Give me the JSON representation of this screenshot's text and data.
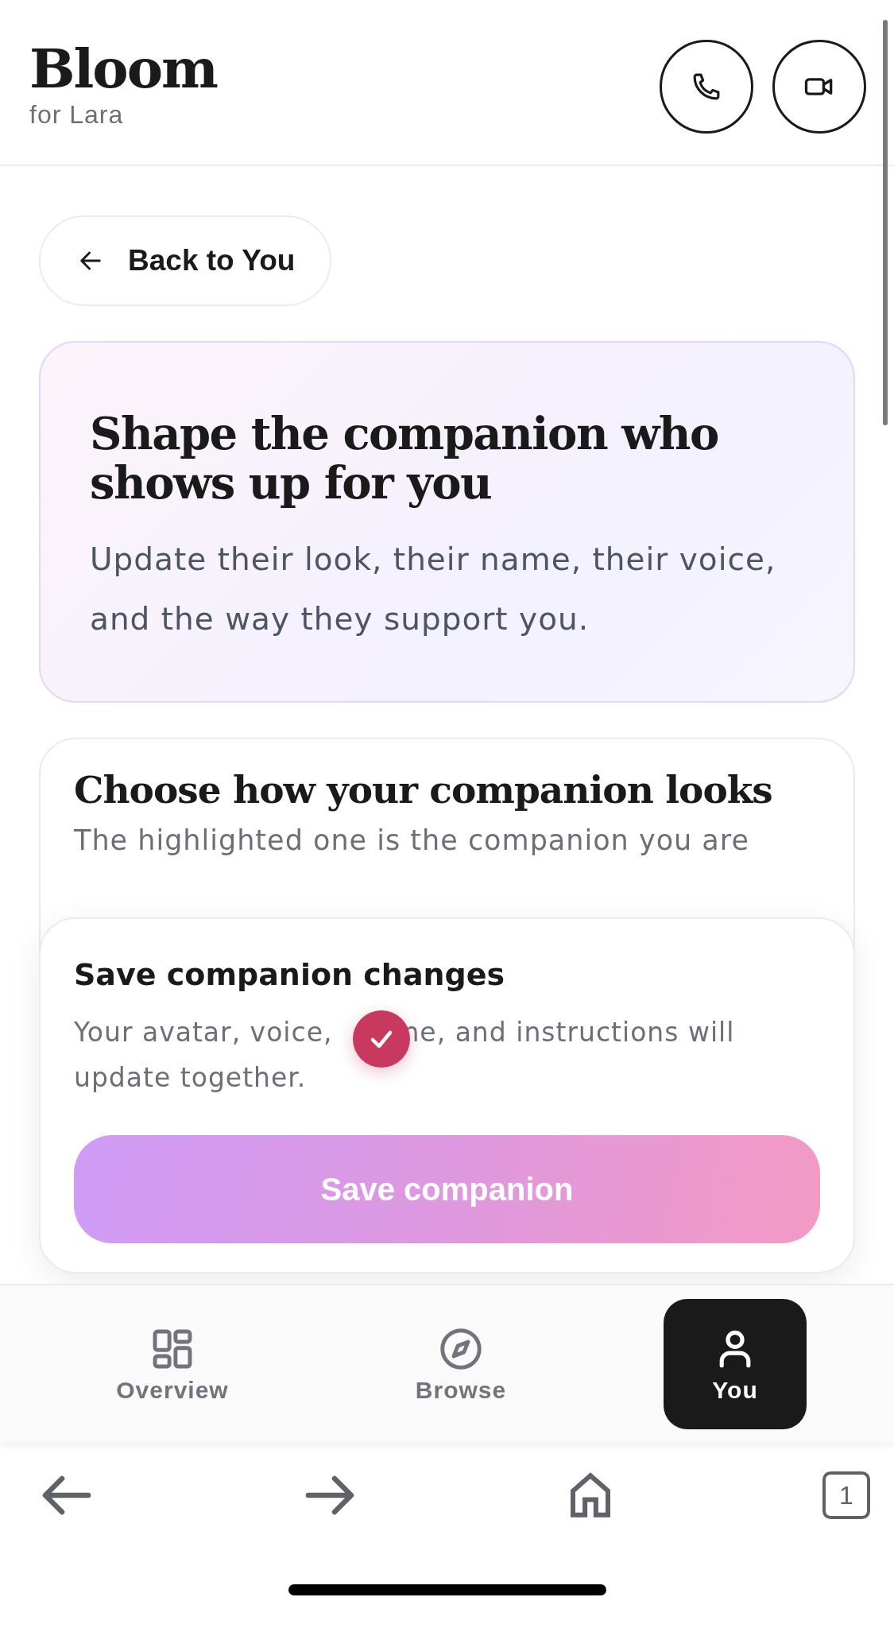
{
  "header": {
    "title": "Bloom",
    "subtitle": "for Lara"
  },
  "back_button": {
    "label": "Back to You"
  },
  "hero": {
    "title": "Shape the companion who shows up for you",
    "description": "Update their look, their name, their voice, and the way they support you."
  },
  "appearance_section": {
    "title": "Choose how your companion looks",
    "description": "The highlighted one is the companion you are"
  },
  "save_panel": {
    "title": "Save companion changes",
    "description_lines": [
      "Your avatar, voice,",
      "ne, and instructions will",
      "update together."
    ],
    "button": "Save companion"
  },
  "bottom_nav": [
    {
      "label": "Overview",
      "selected": false
    },
    {
      "label": "Browse",
      "selected": false
    },
    {
      "label": "You",
      "selected": true
    }
  ],
  "browser_toolbar": {
    "tab_count": "1"
  }
}
